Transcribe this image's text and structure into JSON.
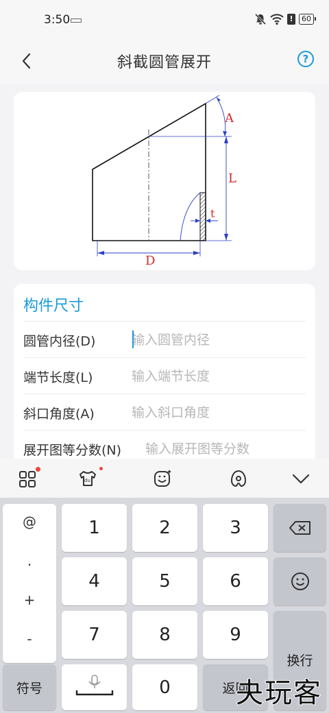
{
  "status_bar": {
    "time": "3:50",
    "battery": "60",
    "alert": "!"
  },
  "header": {
    "title": "斜截圆管展开",
    "help": "?"
  },
  "diagram": {
    "label_A": "A",
    "label_L": "L",
    "label_t": "t",
    "label_D": "D"
  },
  "form": {
    "section_title": "构件尺寸",
    "fields": [
      {
        "label": "圆管内径(D)",
        "placeholder": "输入圆管内径"
      },
      {
        "label": "端节长度(L)",
        "placeholder": "输入端节长度"
      },
      {
        "label": "斜口角度(A)",
        "placeholder": "输入斜口角度"
      },
      {
        "label": "展开图等分数(N)",
        "placeholder": "输入展开图等分数"
      }
    ]
  },
  "keyboard": {
    "symbols": [
      "@",
      ".",
      "+",
      "-"
    ],
    "digits": [
      "1",
      "2",
      "3",
      "4",
      "5",
      "6",
      "7",
      "8",
      "9",
      "0"
    ],
    "symbol_key": "符号",
    "enter_key": "换行",
    "return_key": "返回"
  },
  "watermark": "夬玩客"
}
